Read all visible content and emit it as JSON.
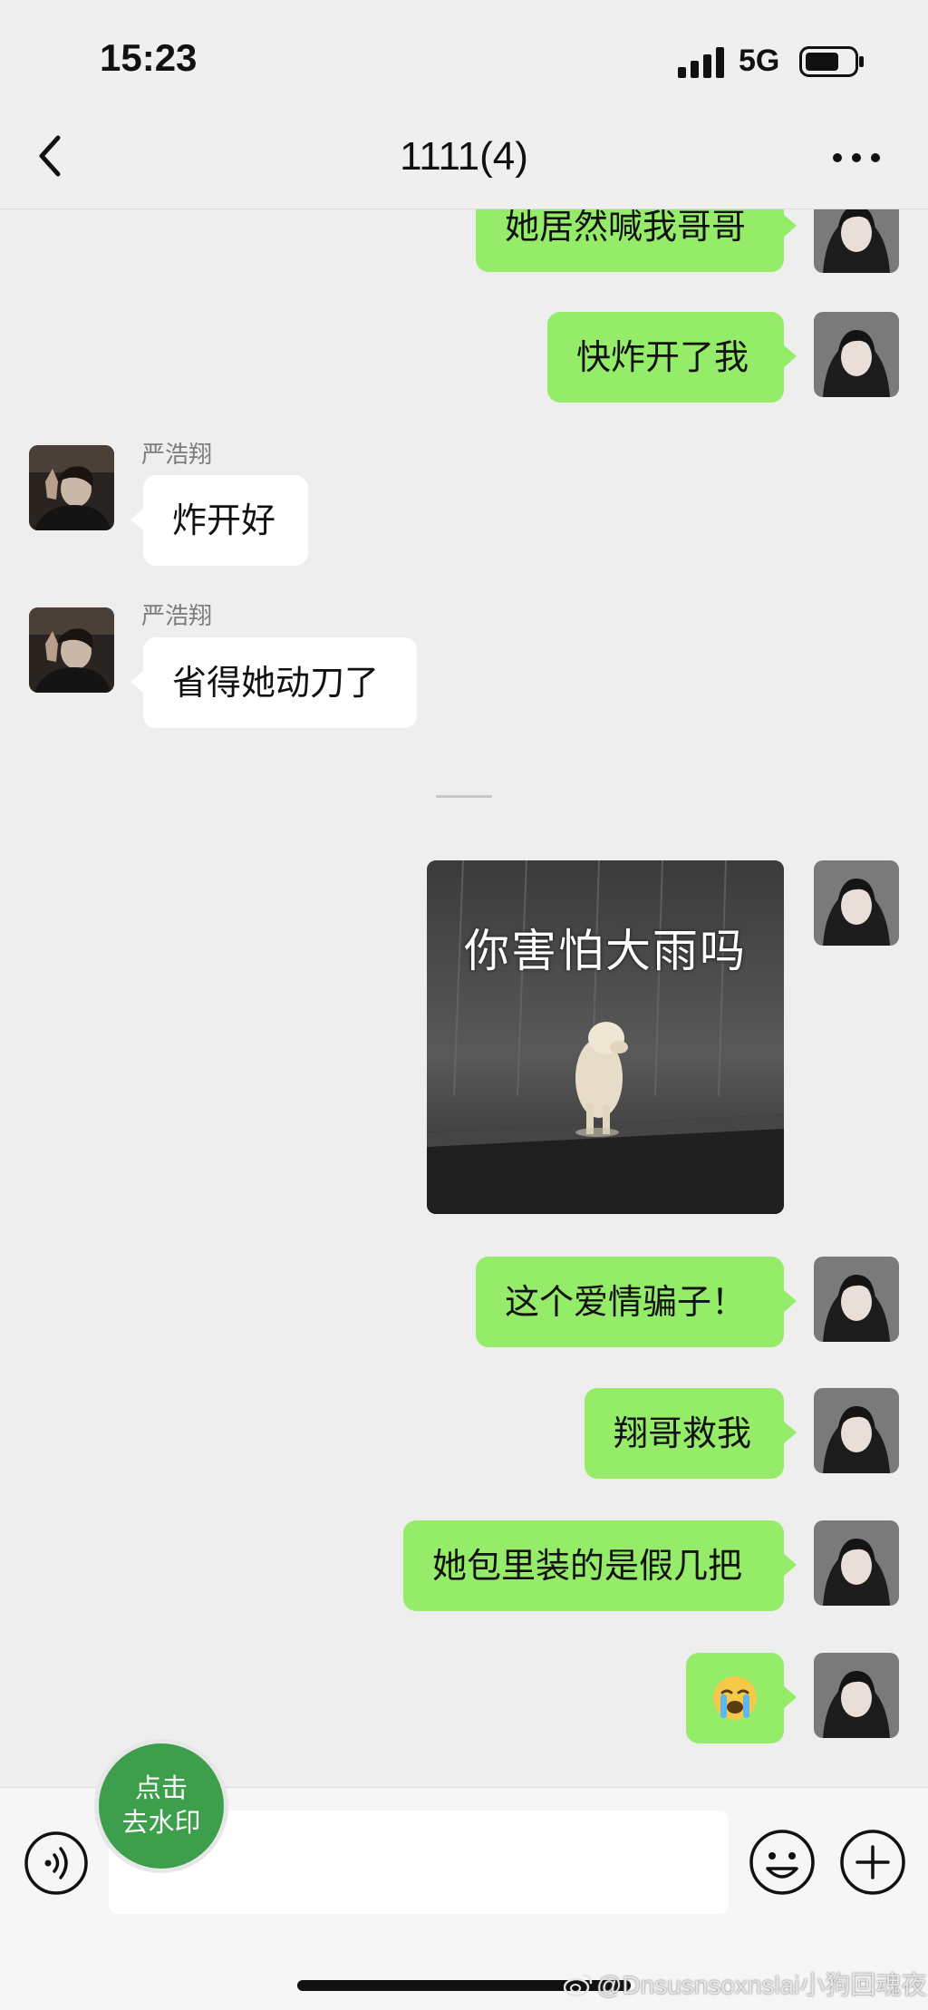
{
  "status_bar": {
    "time": "15:23",
    "network": "5G"
  },
  "nav": {
    "title": "1111(4)",
    "back_icon": "chevron-left-icon",
    "more_icon": "ellipsis-icon"
  },
  "messages": [
    {
      "type": "text",
      "side": "out",
      "text": "她居然喊我哥哥"
    },
    {
      "type": "text",
      "side": "out",
      "text": "快炸开了我"
    },
    {
      "type": "text",
      "side": "in",
      "sender": "严浩翔",
      "text": "炸开好"
    },
    {
      "type": "text",
      "side": "in",
      "sender": "严浩翔",
      "text": "省得她动刀了"
    },
    {
      "type": "sticker",
      "side": "out",
      "caption": "你害怕大雨吗"
    },
    {
      "type": "text",
      "side": "out",
      "text": "这个爱情骗子！"
    },
    {
      "type": "text",
      "side": "out",
      "text": "翔哥救我"
    },
    {
      "type": "text",
      "side": "out",
      "text": "她包里装的是假几把"
    },
    {
      "type": "emoji",
      "side": "out",
      "emoji_name": "loudly-crying-face-icon"
    }
  ],
  "input_bar": {
    "placeholder": "",
    "voice_icon": "voice-icon",
    "emoji_icon": "smiley-icon",
    "plus_icon": "plus-icon"
  },
  "overlay": {
    "remove_watermark_line1": "点击",
    "remove_watermark_line2": "去水印",
    "credit": "@Dnsusnsoxnslai小狗回魂夜"
  },
  "colors": {
    "outgoing_bubble": "#95ec69",
    "incoming_bubble": "#ffffff",
    "background": "#eeeeee",
    "watermark_button": "#3d9f4c"
  }
}
